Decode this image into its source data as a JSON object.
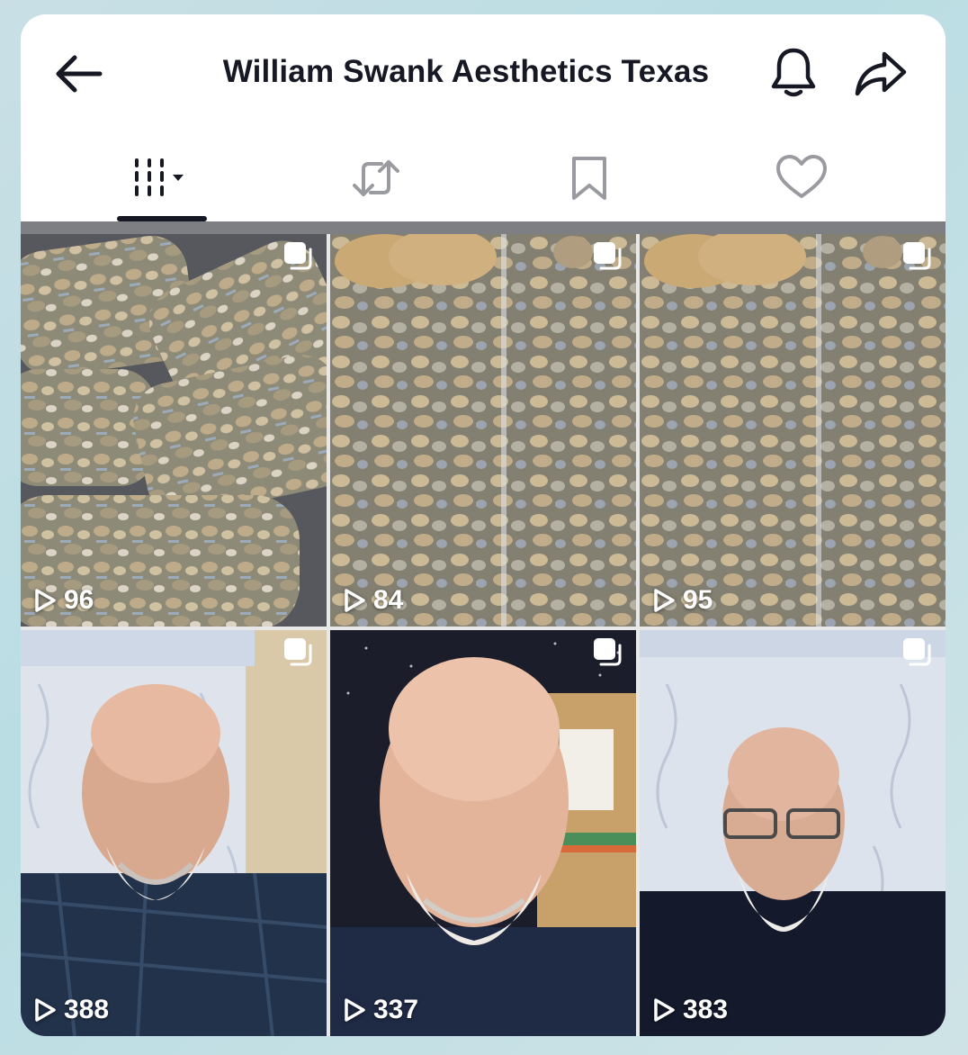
{
  "header": {
    "title": "William Swank Aesthetics Texas",
    "back_icon": "arrow-left-icon",
    "bell_icon": "bell-icon",
    "share_icon": "share-arrow-icon"
  },
  "tabs": [
    {
      "name": "videos",
      "icon": "grid-dropdown-icon",
      "active": true
    },
    {
      "name": "reposts",
      "icon": "repost-icon",
      "active": false
    },
    {
      "name": "favorites",
      "icon": "bookmark-icon",
      "active": false
    },
    {
      "name": "liked",
      "icon": "heart-icon",
      "active": false
    }
  ],
  "videos": [
    {
      "views": "96",
      "subject": "bags of dried mushrooms"
    },
    {
      "views": "84",
      "subject": "bags of dried mushrooms"
    },
    {
      "views": "95",
      "subject": "bags of dried mushrooms"
    },
    {
      "views": "388",
      "subject": "bald man with white beard in front of curtain"
    },
    {
      "views": "337",
      "subject": "bald man with white beard indoors"
    },
    {
      "views": "383",
      "subject": "bald man with glasses and white beard in front of curtain"
    }
  ],
  "colors": {
    "text": "#161823",
    "divider": "#7d7f83",
    "background": "#b9dde3"
  }
}
